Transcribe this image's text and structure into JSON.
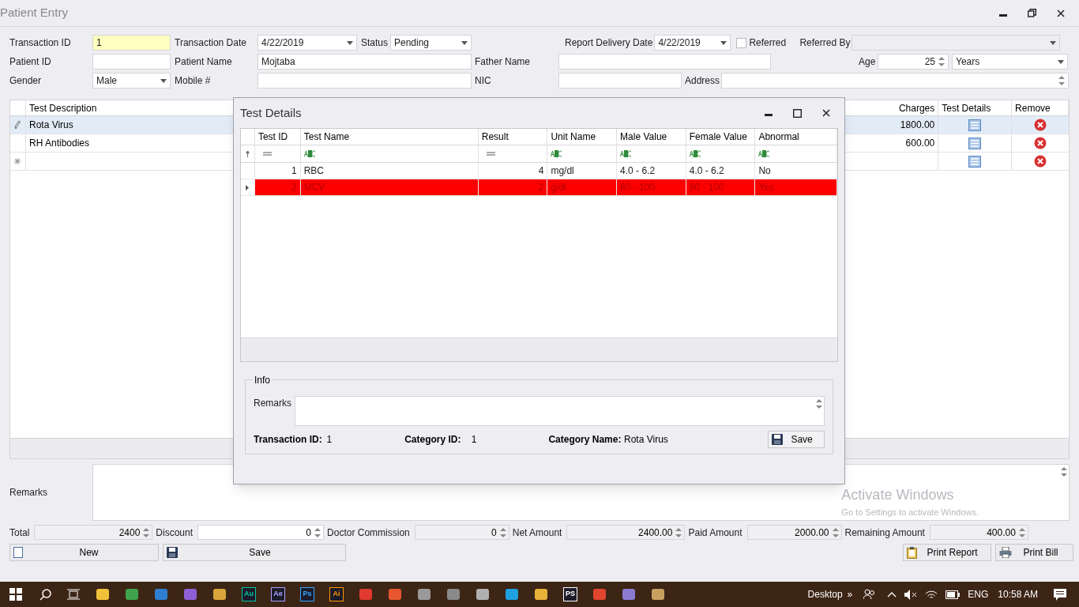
{
  "window": {
    "title": "Patient Entry"
  },
  "fields": {
    "transaction_id": {
      "label": "Transaction ID",
      "value": "1",
      "focused": true
    },
    "transaction_date": {
      "label": "Transaction Date",
      "value": "4/22/2019"
    },
    "status": {
      "label": "Status",
      "value": "Pending"
    },
    "report_delivery_date": {
      "label": "Report Delivery Date",
      "value": "4/22/2019"
    },
    "referred": {
      "label": "Referred",
      "checked": false
    },
    "referred_by": {
      "label": "Referred By",
      "disabled": true
    },
    "patient_id": {
      "label": "Patient ID"
    },
    "patient_name": {
      "label": "Patient Name",
      "value": "Mojtaba"
    },
    "father_name": {
      "label": "Father Name"
    },
    "age": {
      "label": "Age",
      "value": "25",
      "unit": "Years"
    },
    "gender": {
      "label": "Gender",
      "value": "Male"
    },
    "mobile": {
      "label": "Mobile #"
    },
    "nic": {
      "label": "NIC"
    },
    "address": {
      "label": "Address"
    }
  },
  "tests": {
    "columns": [
      "Test Description",
      "Charges",
      "Test Details",
      "Remove"
    ],
    "rows": [
      {
        "description": "Rota Virus",
        "charges": "1800.00",
        "selected": true
      },
      {
        "description": "RH Antibodies",
        "charges": "600.00",
        "selected": false
      }
    ]
  },
  "remarks": {
    "label": "Remarks"
  },
  "totals": [
    {
      "label": "Total",
      "value": "2400",
      "editable": false
    },
    {
      "label": "Discount",
      "value": "0",
      "editable": true
    },
    {
      "label": "Doctor Commission",
      "value": "0",
      "editable": false
    },
    {
      "label": "Net Amount",
      "value": "2400.00",
      "editable": false
    },
    {
      "label": "Paid Amount",
      "value": "2000.00",
      "editable": false
    },
    {
      "label": "Remaining Amount",
      "value": "400.00",
      "editable": false
    }
  ],
  "buttons": [
    {
      "label": "New"
    },
    {
      "label": "Save"
    },
    {
      "label": "Print Report"
    },
    {
      "label": "Print Bill"
    }
  ],
  "dialog": {
    "title": "Test Details",
    "columns": [
      {
        "label": "Test ID",
        "kind": "number"
      },
      {
        "label": "Test Name",
        "kind": "text"
      },
      {
        "label": "Result",
        "kind": "number"
      },
      {
        "label": "Unit Name",
        "kind": "text"
      },
      {
        "label": "Male Value",
        "kind": "text"
      },
      {
        "label": "Female Value",
        "kind": "text"
      },
      {
        "label": "Abnormal",
        "kind": "text"
      }
    ],
    "rows": [
      {
        "cells": [
          "1",
          "RBC",
          "4",
          "mg/dl",
          "4.0 - 6.2",
          "4.0 - 6.2",
          "No"
        ],
        "abnormal": false,
        "selected": false
      },
      {
        "cells": [
          "2",
          "MCV",
          "2",
          "g/dl",
          "80 - 100",
          "80 - 100",
          "Yes"
        ],
        "abnormal": true,
        "selected": true
      }
    ],
    "info": {
      "title": "Info",
      "remarks_label": "Remarks",
      "transaction_id_label": "Transaction ID:",
      "transaction_id": "1",
      "category_id_label": "Category ID:",
      "category_id": "1",
      "category_name_label": "Category Name:",
      "category_name": "Rota Virus",
      "save": "Save"
    }
  },
  "activation": {
    "title": "Activate Windows",
    "hint": "Go to Settings to activate Windows."
  },
  "taskbar": {
    "apps": [
      {
        "kind": "icon",
        "color": "#f2c13a"
      },
      {
        "kind": "icon",
        "color": "#3fa34d"
      },
      {
        "kind": "icon",
        "color": "#2f7fd1"
      },
      {
        "kind": "icon",
        "color": "#8e5fd6"
      },
      {
        "kind": "icon",
        "color": "#d9a53a"
      },
      {
        "kind": "letters",
        "text": "Au",
        "color": "#00c8a0"
      },
      {
        "kind": "letters",
        "text": "Ae",
        "color": "#b0a0ff"
      },
      {
        "kind": "letters",
        "text": "Ps",
        "color": "#31a8ff"
      },
      {
        "kind": "letters",
        "text": "Ai",
        "color": "#ff9a00"
      },
      {
        "kind": "icon",
        "color": "#e0392f"
      },
      {
        "kind": "icon",
        "color": "#e8562f"
      },
      {
        "kind": "icon",
        "color": "#9a9a9a"
      },
      {
        "kind": "icon",
        "color": "#8a8a8a"
      },
      {
        "kind": "icon",
        "color": "#b0b0b0"
      },
      {
        "kind": "icon",
        "color": "#1fa0e0"
      },
      {
        "kind": "icon",
        "color": "#e8b23a"
      },
      {
        "kind": "letters",
        "text": "PS",
        "color": "#ffffff"
      },
      {
        "kind": "icon",
        "color": "#e0452f"
      },
      {
        "kind": "icon",
        "color": "#8a7ad0"
      },
      {
        "kind": "icon",
        "color": "#c8a060"
      }
    ],
    "desktop": "Desktop",
    "chevron": "»",
    "language": "ENG",
    "time": "10:58 AM"
  }
}
